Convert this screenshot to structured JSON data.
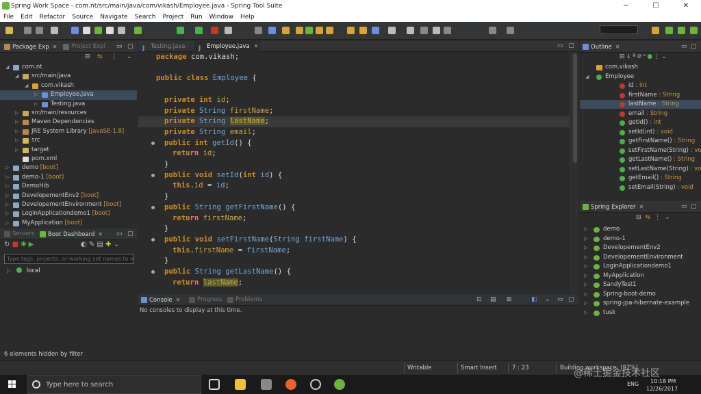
{
  "window": {
    "title": "Spring Work Space - com.nt/src/main/java/com/vikash/Employee.java - Spring Tool Suite",
    "min": "─",
    "max": "☐",
    "close": "✕"
  },
  "menu": [
    "File",
    "Edit",
    "Refactor",
    "Source",
    "Navigate",
    "Search",
    "Project",
    "Run",
    "Window",
    "Help"
  ],
  "package_explorer": {
    "tabs": [
      {
        "label": "Package Exp"
      },
      {
        "label": "Project Expl"
      }
    ],
    "items": [
      {
        "label": "com.nt",
        "suffix": "",
        "indent": 0,
        "arrow": "◢",
        "icon": "project",
        "color": "#8aa9c9"
      },
      {
        "label": "src/main/java",
        "suffix": "",
        "indent": 1,
        "arrow": "◢",
        "icon": "src-folder",
        "color": "#c9a85a"
      },
      {
        "label": "com.vikash",
        "suffix": "",
        "indent": 2,
        "arrow": "◢",
        "icon": "package",
        "color": "#d6a23d"
      },
      {
        "label": "Employee.java",
        "suffix": "",
        "indent": 3,
        "arrow": "▷",
        "icon": "java-file",
        "color": "#6d8fd8",
        "selected": true
      },
      {
        "label": "Testing.java",
        "suffix": "",
        "indent": 3,
        "arrow": "▷",
        "icon": "java-file",
        "color": "#6d8fd8"
      },
      {
        "label": "src/main/resources",
        "suffix": "",
        "indent": 1,
        "arrow": "▷",
        "icon": "src-folder",
        "color": "#c9a85a"
      },
      {
        "label": "Maven Dependencies",
        "suffix": "",
        "indent": 1,
        "arrow": "▷",
        "icon": "library",
        "color": "#b58a4c"
      },
      {
        "label": "JRE System Library",
        "suffix": " [JavaSE-1.8]",
        "indent": 1,
        "arrow": "▷",
        "icon": "library",
        "color": "#b58a4c"
      },
      {
        "label": "src",
        "suffix": "",
        "indent": 1,
        "arrow": "▷",
        "icon": "folder",
        "color": "#d6b656"
      },
      {
        "label": "target",
        "suffix": "",
        "indent": 1,
        "arrow": "▷",
        "icon": "folder",
        "color": "#d6b656"
      },
      {
        "label": "pom.xml",
        "suffix": "",
        "indent": 1,
        "arrow": "",
        "icon": "xml-file",
        "color": "#dddddd"
      },
      {
        "label": "demo",
        "suffix": " [boot]",
        "indent": 0,
        "arrow": "▷",
        "icon": "project",
        "color": "#8aa9c9"
      },
      {
        "label": "demo-1",
        "suffix": " [boot]",
        "indent": 0,
        "arrow": "▷",
        "icon": "project",
        "color": "#8aa9c9"
      },
      {
        "label": "DemoHib",
        "suffix": "",
        "indent": 0,
        "arrow": "▷",
        "icon": "project",
        "color": "#8aa9c9"
      },
      {
        "label": "DevelopementEnv2",
        "suffix": " [boot]",
        "indent": 0,
        "arrow": "▷",
        "icon": "project",
        "color": "#8aa9c9"
      },
      {
        "label": "DevelopementEnvironment",
        "suffix": " [boot]",
        "indent": 0,
        "arrow": "▷",
        "icon": "project",
        "color": "#8aa9c9"
      },
      {
        "label": "LoginApplicationdemo1",
        "suffix": " [boot]",
        "indent": 0,
        "arrow": "▷",
        "icon": "project",
        "color": "#8aa9c9"
      },
      {
        "label": "MyApplication",
        "suffix": " [boot]",
        "indent": 0,
        "arrow": "▷",
        "icon": "project",
        "color": "#8aa9c9"
      }
    ]
  },
  "boot_dashboard": {
    "tabs": [
      {
        "label": "Servers"
      },
      {
        "label": "Boot Dashboard"
      }
    ],
    "filter_placeholder": "Type tags, projects, or working set names to match (incl. * and ? wildcards)",
    "items": [
      {
        "label": "local"
      }
    ],
    "footer": "6 elements hidden by filter"
  },
  "editor": {
    "tabs": [
      {
        "label": "Testing.java",
        "active": false
      },
      {
        "label": "Employee.java",
        "active": true
      }
    ],
    "lines": [
      {
        "indent": 0,
        "marker": false,
        "current": false,
        "spans": [
          {
            "t": "package ",
            "c": "kw"
          },
          {
            "t": "com.vikash;",
            "c": ""
          }
        ]
      },
      {
        "indent": 0,
        "marker": false,
        "current": false,
        "spans": []
      },
      {
        "indent": 0,
        "marker": false,
        "current": false,
        "spans": [
          {
            "t": "public class ",
            "c": "kw"
          },
          {
            "t": "Employee",
            "c": "ty"
          },
          {
            "t": " {",
            "c": ""
          }
        ]
      },
      {
        "indent": 0,
        "marker": false,
        "current": false,
        "spans": []
      },
      {
        "indent": 1,
        "marker": false,
        "current": false,
        "spans": [
          {
            "t": "private int ",
            "c": "kw"
          },
          {
            "t": "id",
            "c": "fld"
          },
          {
            "t": ";",
            "c": ""
          }
        ]
      },
      {
        "indent": 1,
        "marker": false,
        "current": false,
        "spans": [
          {
            "t": "private ",
            "c": "kw"
          },
          {
            "t": "String ",
            "c": "ty"
          },
          {
            "t": "firstName",
            "c": "fld"
          },
          {
            "t": ";",
            "c": ""
          }
        ]
      },
      {
        "indent": 1,
        "marker": false,
        "current": true,
        "spans": [
          {
            "t": "private ",
            "c": "kw"
          },
          {
            "t": "String ",
            "c": "ty"
          },
          {
            "t": "lastName",
            "c": "fld hl"
          },
          {
            "t": ";",
            "c": ""
          }
        ]
      },
      {
        "indent": 1,
        "marker": false,
        "current": false,
        "spans": [
          {
            "t": "private ",
            "c": "kw"
          },
          {
            "t": "String ",
            "c": "ty"
          },
          {
            "t": "email",
            "c": "fld"
          },
          {
            "t": ";",
            "c": ""
          }
        ]
      },
      {
        "indent": 1,
        "marker": true,
        "current": false,
        "spans": [
          {
            "t": "public int ",
            "c": "kw"
          },
          {
            "t": "getId",
            "c": "ty"
          },
          {
            "t": "() {",
            "c": ""
          }
        ]
      },
      {
        "indent": 2,
        "marker": false,
        "current": false,
        "spans": [
          {
            "t": "return ",
            "c": "kw"
          },
          {
            "t": "id",
            "c": "fld"
          },
          {
            "t": ";",
            "c": ""
          }
        ]
      },
      {
        "indent": 1,
        "marker": false,
        "current": false,
        "spans": [
          {
            "t": "}",
            "c": ""
          }
        ]
      },
      {
        "indent": 1,
        "marker": true,
        "current": false,
        "spans": [
          {
            "t": "public void ",
            "c": "kw"
          },
          {
            "t": "setId",
            "c": "ty"
          },
          {
            "t": "(",
            "c": ""
          },
          {
            "t": "int ",
            "c": "kw"
          },
          {
            "t": "id",
            "c": "ty"
          },
          {
            "t": ") {",
            "c": ""
          }
        ]
      },
      {
        "indent": 2,
        "marker": false,
        "current": false,
        "spans": [
          {
            "t": "this",
            "c": "kw"
          },
          {
            "t": ".",
            "c": ""
          },
          {
            "t": "id",
            "c": "fld"
          },
          {
            "t": " = ",
            "c": ""
          },
          {
            "t": "id",
            "c": "ty"
          },
          {
            "t": ";",
            "c": ""
          }
        ]
      },
      {
        "indent": 1,
        "marker": false,
        "current": false,
        "spans": [
          {
            "t": "}",
            "c": ""
          }
        ]
      },
      {
        "indent": 1,
        "marker": true,
        "current": false,
        "spans": [
          {
            "t": "public ",
            "c": "kw"
          },
          {
            "t": "String ",
            "c": "ty"
          },
          {
            "t": "getFirstName",
            "c": "ty"
          },
          {
            "t": "() {",
            "c": ""
          }
        ]
      },
      {
        "indent": 2,
        "marker": false,
        "current": false,
        "spans": [
          {
            "t": "return ",
            "c": "kw"
          },
          {
            "t": "firstName",
            "c": "fld"
          },
          {
            "t": ";",
            "c": ""
          }
        ]
      },
      {
        "indent": 1,
        "marker": false,
        "current": false,
        "spans": [
          {
            "t": "}",
            "c": ""
          }
        ]
      },
      {
        "indent": 1,
        "marker": true,
        "current": false,
        "spans": [
          {
            "t": "public void ",
            "c": "kw"
          },
          {
            "t": "setFirstName",
            "c": "ty"
          },
          {
            "t": "(",
            "c": ""
          },
          {
            "t": "String ",
            "c": "ty"
          },
          {
            "t": "firstName",
            "c": "ty"
          },
          {
            "t": ") {",
            "c": ""
          }
        ]
      },
      {
        "indent": 2,
        "marker": false,
        "current": false,
        "spans": [
          {
            "t": "this",
            "c": "kw"
          },
          {
            "t": ".",
            "c": ""
          },
          {
            "t": "firstName",
            "c": "fld"
          },
          {
            "t": " = ",
            "c": ""
          },
          {
            "t": "firstName",
            "c": "ty"
          },
          {
            "t": ";",
            "c": ""
          }
        ]
      },
      {
        "indent": 1,
        "marker": false,
        "current": false,
        "spans": [
          {
            "t": "}",
            "c": ""
          }
        ]
      },
      {
        "indent": 1,
        "marker": true,
        "current": false,
        "spans": [
          {
            "t": "public ",
            "c": "kw"
          },
          {
            "t": "String ",
            "c": "ty"
          },
          {
            "t": "getLastName",
            "c": "ty"
          },
          {
            "t": "() {",
            "c": ""
          }
        ]
      },
      {
        "indent": 2,
        "marker": false,
        "current": false,
        "spans": [
          {
            "t": "return ",
            "c": "kw"
          },
          {
            "t": "lastName",
            "c": "fld hl"
          },
          {
            "t": ";",
            "c": ""
          }
        ]
      }
    ]
  },
  "console": {
    "tabs": [
      {
        "label": "Console",
        "active": true
      },
      {
        "label": "Progress",
        "active": false
      },
      {
        "label": "Problems",
        "active": false
      }
    ],
    "message": "No consoles to display at this time."
  },
  "outline": {
    "tab": "Outline",
    "items": [
      {
        "label": "com.vikash",
        "type": "",
        "indent": 0,
        "icon": "package",
        "color": "#d6a23d",
        "selected": false
      },
      {
        "label": "Employee",
        "type": "",
        "indent": 0,
        "icon": "class",
        "color": "#4caf50",
        "selected": false
      },
      {
        "label": "id",
        "type": " : int",
        "indent": 1,
        "icon": "private-field",
        "color": "#c0392b",
        "selected": false
      },
      {
        "label": "firstName",
        "type": " : String",
        "indent": 1,
        "icon": "private-field",
        "color": "#c0392b",
        "selected": false
      },
      {
        "label": "lastName",
        "type": " : String",
        "indent": 1,
        "icon": "private-field",
        "color": "#c0392b",
        "selected": true
      },
      {
        "label": "email",
        "type": " : String",
        "indent": 1,
        "icon": "private-field",
        "color": "#c0392b",
        "selected": false
      },
      {
        "label": "getId()",
        "type": " : int",
        "indent": 1,
        "icon": "public-method",
        "color": "#4caf50",
        "selected": false
      },
      {
        "label": "setId(int)",
        "type": " : void",
        "indent": 1,
        "icon": "public-method",
        "color": "#4caf50",
        "selected": false
      },
      {
        "label": "getFirstName()",
        "type": " : String",
        "indent": 1,
        "icon": "public-method",
        "color": "#4caf50",
        "selected": false
      },
      {
        "label": "setFirstName(String)",
        "type": " : void",
        "indent": 1,
        "icon": "public-method",
        "color": "#4caf50",
        "selected": false
      },
      {
        "label": "getLastName()",
        "type": " : String",
        "indent": 1,
        "icon": "public-method",
        "color": "#4caf50",
        "selected": false
      },
      {
        "label": "setLastName(String)",
        "type": " : void",
        "indent": 1,
        "icon": "public-method",
        "color": "#4caf50",
        "selected": false
      },
      {
        "label": "getEmail()",
        "type": " : String",
        "indent": 1,
        "icon": "public-method",
        "color": "#4caf50",
        "selected": false
      },
      {
        "label": "setEmail(String)",
        "type": " : void",
        "indent": 1,
        "icon": "public-method",
        "color": "#4caf50",
        "selected": false
      }
    ]
  },
  "spring_explorer": {
    "tab": "Spring Explorer",
    "items": [
      "demo",
      "demo-1",
      "DevelopementEnv2",
      "DevelopementEnvironment",
      "LoginApplicationdemo1",
      "MyApplication",
      "SandyTest1",
      "Spring-boot-demo",
      "spring-jpa-hibernate-example",
      "tusk"
    ]
  },
  "statusbar": {
    "writable": "Writable",
    "insert": "Smart Insert",
    "position": "7 : 23",
    "task": "Building workspace: (97%)"
  },
  "taskbar": {
    "search_placeholder": "Type here to search",
    "time": "10:18 PM",
    "date": "12/26/2017",
    "lang": "ENG"
  },
  "watermark": "@稀土掘金技术社区",
  "colors": {
    "accent": "#6db33f",
    "keyword": "#d28d25",
    "type": "#6fa8dc",
    "field": "#c9a440",
    "background": "#2b2b2b"
  }
}
